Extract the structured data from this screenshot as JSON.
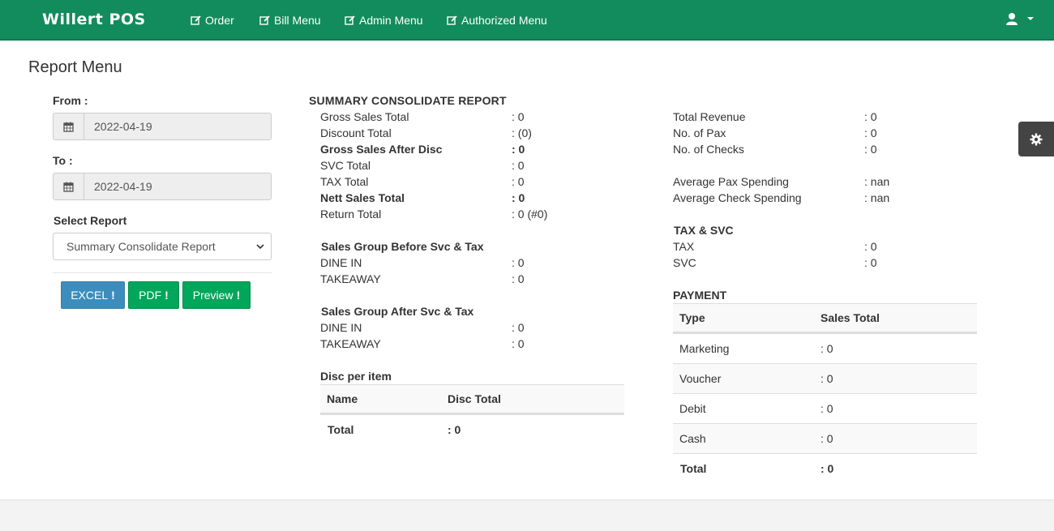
{
  "navbar": {
    "brand": "Willert POS",
    "items": [
      {
        "label": "Order"
      },
      {
        "label": "Bill Menu"
      },
      {
        "label": "Admin Menu"
      },
      {
        "label": "Authorized Menu"
      }
    ],
    "user_icon": "user-icon",
    "bg_color": "#128c5c"
  },
  "page": {
    "title": "Report Menu"
  },
  "form": {
    "from_label": "From :",
    "from_value": "2022-04-19",
    "to_label": "To :",
    "to_value": "2022-04-19",
    "select_label": "Select Report",
    "select_value": "Summary Consolidate Report",
    "buttons": {
      "excel": "EXCEL",
      "pdf": "PDF",
      "preview": "Preview"
    }
  },
  "report": {
    "title": "SUMMARY CONSOLIDATE REPORT",
    "summary": [
      {
        "label": "Gross Sales Total",
        "value": ": 0"
      },
      {
        "label": "Discount Total",
        "value": ": (0)"
      },
      {
        "label": "Gross Sales After Disc",
        "value": ": 0"
      },
      {
        "label": "SVC Total",
        "value": ": 0"
      },
      {
        "label": "TAX Total",
        "value": ": 0"
      },
      {
        "label": "Nett Sales Total",
        "value": ": 0"
      },
      {
        "label": "Return Total",
        "value": ": 0 (#0)"
      }
    ],
    "group_before": {
      "title": "Sales Group Before Svc & Tax",
      "rows": [
        {
          "label": "DINE IN",
          "value": ": 0"
        },
        {
          "label": "TAKEAWAY",
          "value": ": 0"
        }
      ]
    },
    "group_after": {
      "title": "Sales Group After Svc & Tax",
      "rows": [
        {
          "label": "DINE IN",
          "value": ": 0"
        },
        {
          "label": "TAKEAWAY",
          "value": ": 0"
        }
      ]
    },
    "disc_per_item": {
      "title": "Disc per item",
      "headers": [
        "Name",
        "Disc Total"
      ],
      "total_label": "Total",
      "total_value": ": 0"
    },
    "right": [
      {
        "label": "Total Revenue",
        "value": ": 0"
      },
      {
        "label": "No. of Pax",
        "value": ": 0"
      },
      {
        "label": "No. of Checks",
        "value": ": 0"
      },
      {
        "label": "Average Pax Spending",
        "value": ": nan"
      },
      {
        "label": "Average Check Spending",
        "value": ": nan"
      }
    ],
    "tax_svc": {
      "title": "TAX & SVC",
      "rows": [
        {
          "label": "TAX",
          "value": ": 0"
        },
        {
          "label": "SVC",
          "value": ": 0"
        }
      ]
    },
    "payment": {
      "title": "PAYMENT",
      "headers": [
        "Type",
        "Sales Total"
      ],
      "rows": [
        {
          "type": "Marketing",
          "value": ": 0"
        },
        {
          "type": "Voucher",
          "value": ": 0"
        },
        {
          "type": "Debit",
          "value": ": 0"
        },
        {
          "type": "Cash",
          "value": ": 0"
        }
      ],
      "total_label": "Total",
      "total_value": ": 0"
    }
  },
  "settings_icon": "gear-icon"
}
